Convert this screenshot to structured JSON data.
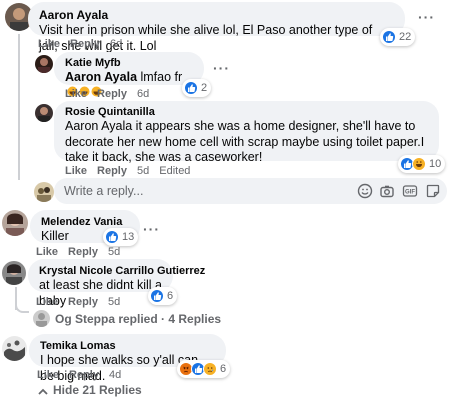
{
  "comments": [
    {
      "author": "Aaron Ayala",
      "text": "Visit her in prison while she alive lol, El Paso another type of jail, she will get it. Lol",
      "like": "Like",
      "reply": "Reply",
      "time": "6d",
      "reaction_count": "22"
    },
    {
      "author": "Katie Myfb",
      "mention": "Aaron Ayala",
      "text": " lmfao fr",
      "like": "Like",
      "reply": "Reply",
      "time": "6d",
      "reaction_count": "2"
    },
    {
      "author": "Rosie Quintanilla",
      "mention": "Aaron Ayala",
      "text": " it appears she was a home designer, she'll have to decorate her new home cell with scrap maybe using toilet paper.I take it back, she was a caseworker!",
      "like": "Like",
      "reply": "Reply",
      "time": "5d",
      "edited": "Edited",
      "reaction_count": "10"
    },
    {
      "author": "Melendez Vania",
      "text": "Killer",
      "like": "Like",
      "reply": "Reply",
      "time": "5d",
      "reaction_count": "13"
    },
    {
      "author": "Krystal Nicole Carrillo Gutierrez",
      "text": "at least she didnt kill a baby",
      "like": "Like",
      "reply": "Reply",
      "time": "5d",
      "reaction_count": "6"
    },
    {
      "author": "Temika Lomas",
      "text": "I hope she walks so y'all can be big mad.",
      "like": "Like",
      "reply": "Reply",
      "time": "4d",
      "reaction_count": "6"
    }
  ],
  "composer": {
    "placeholder": "Write a reply..."
  },
  "thread": {
    "replied_text": "Og Steppa replied · 4 Replies"
  },
  "hide_replies": "Hide 21 Replies",
  "colors": {
    "bubble": "#f0f2f5",
    "meta": "#65676b",
    "like_blue": "#1b74e4"
  },
  "icons": [
    "more-dots-icon",
    "like-icon",
    "haha-icon",
    "sad-icon",
    "angry-icon",
    "care-icon",
    "emoji-icon",
    "camera-icon",
    "gif-icon",
    "sticker-icon",
    "reply-arrow-icon",
    "chevron-up-icon"
  ]
}
